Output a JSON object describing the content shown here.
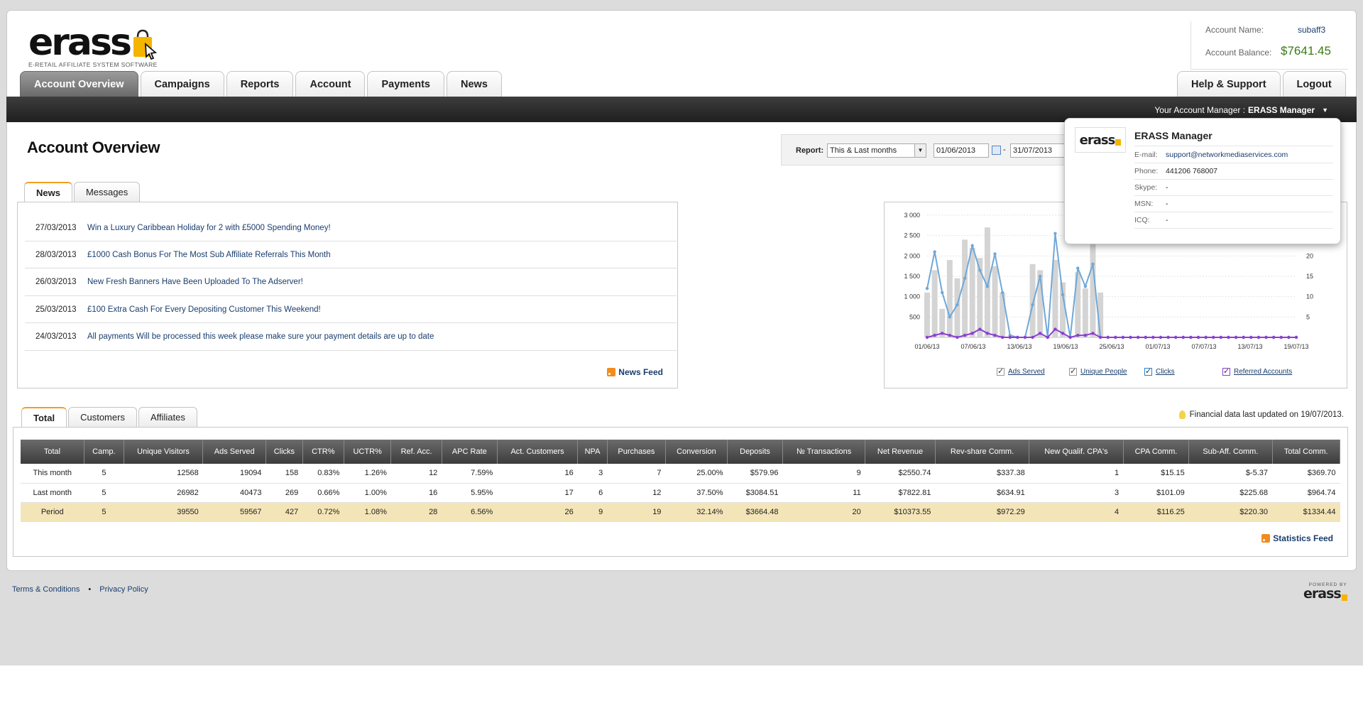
{
  "logo": {
    "word": "erass",
    "tagline": "E-RETAIL AFFILIATE SYSTEM SOFTWARE"
  },
  "account": {
    "name_label": "Account Name:",
    "name": "subaff3",
    "balance_label": "Account Balance:",
    "balance": "$7641.45"
  },
  "nav": {
    "tabs": [
      "Account Overview",
      "Campaigns",
      "Reports",
      "Account",
      "Payments",
      "News"
    ],
    "right_tabs": [
      "Help & Support",
      "Logout"
    ]
  },
  "manager_bar": {
    "label": "Your Account Manager :",
    "name": "ERASS Manager"
  },
  "page_title": "Account Overview",
  "report_filter": {
    "label": "Report:",
    "selected": "This & Last months",
    "date_from": "01/06/2013",
    "date_sep": "-",
    "date_to": "31/07/2013"
  },
  "news_tabs": [
    "News",
    "Messages"
  ],
  "news": [
    {
      "date": "27/03/2013",
      "title": "Win a Luxury Caribbean Holiday for 2 with £5000 Spending Money!"
    },
    {
      "date": "28/03/2013",
      "title": "£1000 Cash Bonus For The Most Sub Affiliate Referrals This Month"
    },
    {
      "date": "26/03/2013",
      "title": "New Fresh Banners Have Been Uploaded To The Adserver!"
    },
    {
      "date": "25/03/2013",
      "title": "£100 Extra Cash For Every Depositing Customer This Weekend!"
    },
    {
      "date": "24/03/2013",
      "title": "All payments Will be processed this week please make sure your payment details are up to date"
    }
  ],
  "news_feed_label": "News Feed",
  "manager_popup": {
    "logo": "erass",
    "name": "ERASS Manager",
    "rows": [
      {
        "label": "E-mail:",
        "value": "support@networkmediaservices.com"
      },
      {
        "label": "Phone:",
        "value": "441206 768007"
      },
      {
        "label": "Skype:",
        "value": "-"
      },
      {
        "label": "MSN:",
        "value": "-"
      },
      {
        "label": "ICQ:",
        "value": "-"
      }
    ]
  },
  "chart_data": {
    "type": "bar",
    "x_tick_labels": [
      "01/06/13",
      "07/06/13",
      "13/06/13",
      "19/06/13",
      "25/06/13",
      "01/07/13",
      "07/07/13",
      "13/07/13",
      "19/07/13"
    ],
    "y_left_ticks": [
      "500",
      "1 000",
      "1 500",
      "2 000",
      "2 500",
      "3 000"
    ],
    "y_right_ticks": [
      "5",
      "10",
      "15",
      "20"
    ],
    "ylim_left": [
      0,
      3000
    ],
    "ylim_right": [
      0,
      30
    ],
    "series": [
      {
        "name": "Ads Served",
        "kind": "bar",
        "values": [
          1100,
          1650,
          700,
          1900,
          1450,
          2400,
          2200,
          1950,
          2700,
          1750,
          1100,
          0,
          0,
          0,
          1800,
          1650,
          0,
          1900,
          1350,
          0,
          1600,
          1200,
          2500,
          1100,
          0,
          0,
          0,
          0,
          0,
          0,
          0,
          0,
          0,
          0,
          0,
          0,
          0,
          0,
          0,
          0,
          0,
          0,
          0,
          0,
          0,
          0,
          0,
          0,
          0,
          0
        ]
      },
      {
        "name": "Unique People",
        "kind": "bar",
        "values": []
      },
      {
        "name": "Clicks",
        "kind": "line",
        "values": [
          1200,
          2100,
          1100,
          500,
          800,
          1450,
          2250,
          1650,
          1250,
          2050,
          1100,
          50,
          0,
          0,
          800,
          1500,
          0,
          2550,
          1050,
          0,
          1700,
          1250,
          1800,
          0,
          0,
          0,
          0,
          0,
          0,
          0,
          0,
          0,
          0,
          0,
          0,
          0,
          0,
          0,
          0,
          0,
          0,
          0,
          0,
          0,
          0,
          0,
          0,
          0,
          0,
          0
        ]
      },
      {
        "name": "Referred Accounts",
        "kind": "line",
        "values": [
          0,
          0.5,
          1,
          0.5,
          0,
          0.5,
          1,
          2,
          1,
          0.5,
          0,
          0,
          0,
          0,
          0,
          1,
          0,
          2,
          1,
          0,
          0.5,
          0.5,
          1,
          0,
          0,
          0,
          0,
          0,
          0,
          0,
          0,
          0,
          0,
          0,
          0,
          0,
          0,
          0,
          0,
          0,
          0,
          0,
          0,
          0,
          0,
          0,
          0,
          0,
          0,
          0
        ]
      }
    ],
    "colors": {
      "bars": "#d4d4d4",
      "clicks": "#6fa8d8",
      "referred": "#8a3fd0"
    }
  },
  "chart_legend": [
    {
      "label": "Ads Served",
      "checked": true,
      "color": "#999999"
    },
    {
      "label": "Unique People",
      "checked": true,
      "color": "#999999"
    },
    {
      "label": "Clicks",
      "checked": true,
      "color": "#2a7fd0"
    },
    {
      "label": "Referred Accounts",
      "checked": true,
      "color": "#8a3fd0"
    }
  ],
  "stats_tabs": [
    "Total",
    "Customers",
    "Affiliates"
  ],
  "financial_update": "Financial data last updated on 19/07/2013.",
  "stats_table": {
    "headers": [
      "Total",
      "Camp.",
      "Unique Visitors",
      "Ads Served",
      "Clicks",
      "CTR%",
      "UCTR%",
      "Ref. Acc.",
      "APC Rate",
      "Act. Customers",
      "NPA",
      "Purchases",
      "Conversion",
      "Deposits",
      "№ Transactions",
      "Net Revenue",
      "Rev-share Comm.",
      "New Qualif. CPA's",
      "CPA Comm.",
      "Sub-Aff. Comm.",
      "Total Comm."
    ],
    "rows": [
      [
        "This month",
        "5",
        "12568",
        "19094",
        "158",
        "0.83%",
        "1.26%",
        "12",
        "7.59%",
        "16",
        "3",
        "7",
        "25.00%",
        "$579.96",
        "9",
        "$2550.74",
        "$337.38",
        "1",
        "$15.15",
        "$-5.37",
        "$369.70"
      ],
      [
        "Last month",
        "5",
        "26982",
        "40473",
        "269",
        "0.66%",
        "1.00%",
        "16",
        "5.95%",
        "17",
        "6",
        "12",
        "37.50%",
        "$3084.51",
        "11",
        "$7822.81",
        "$634.91",
        "3",
        "$101.09",
        "$225.68",
        "$964.74"
      ],
      [
        "Period",
        "5",
        "39550",
        "59567",
        "427",
        "0.72%",
        "1.08%",
        "28",
        "6.56%",
        "26",
        "9",
        "19",
        "32.14%",
        "$3664.48",
        "20",
        "$10373.55",
        "$972.29",
        "4",
        "$116.25",
        "$220.30",
        "$1334.44"
      ]
    ]
  },
  "stats_feed_label": "Statistics Feed",
  "footer": {
    "links": [
      "Terms & Conditions",
      "Privacy Policy"
    ],
    "separator": "•",
    "powered_by": "POWERED BY",
    "powered_logo": "erass"
  }
}
